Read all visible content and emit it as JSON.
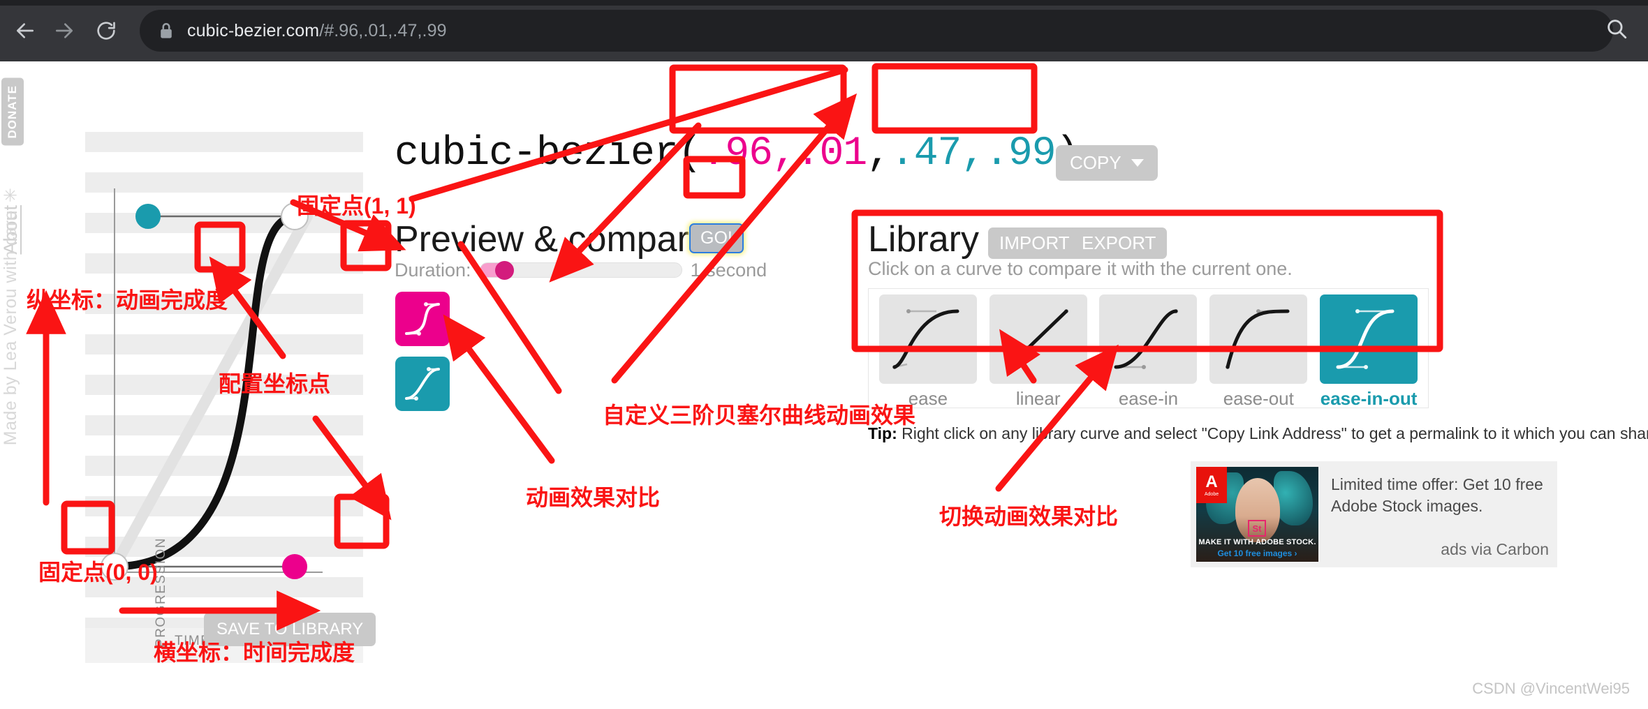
{
  "browser": {
    "url_host": "cubic-bezier.com",
    "url_path": "/#.96,.01,.47,.99",
    "back_icon": "arrow-left-icon",
    "forward_icon": "arrow-right-icon",
    "reload_icon": "reload-icon",
    "lock_icon": "lock-icon",
    "search_icon": "search-icon"
  },
  "sidebar": {
    "donate_label": "DONATE",
    "about_label": "About",
    "credits": "Made by Lea Verou with care ✳"
  },
  "title": {
    "func_name": "cubic-bezier",
    "open_paren": "(",
    "p1": ".96,.01",
    "sep": ",",
    "p2": ".47,.99",
    "close_paren": ")",
    "copy_label": "COPY",
    "pink_hex": "#ec008c",
    "teal_hex": "#1a9bad"
  },
  "editor": {
    "y_axis_label": "PROGRESSION",
    "x_axis_label": "TIME",
    "save_label": "SAVE TO LIBRARY",
    "p1_color": "#1a9bad",
    "p2_color": "#ec008c",
    "p1_value": ".96,.01",
    "p2_value": ".47,.99"
  },
  "preview": {
    "heading": "Preview & compare",
    "go_label": "GO!",
    "duration_label": "Duration:",
    "duration_value": "1 second",
    "swatch_custom": "#ec008c",
    "swatch_compare": "#1a9bad"
  },
  "library": {
    "heading": "Library",
    "import_label": "IMPORT",
    "export_label": "EXPORT",
    "hint": "Click on a curve to compare it with the current one.",
    "items": [
      {
        "label": "ease",
        "selected": false
      },
      {
        "label": "linear",
        "selected": false
      },
      {
        "label": "ease-in",
        "selected": false
      },
      {
        "label": "ease-out",
        "selected": false
      },
      {
        "label": "ease-in-out",
        "selected": true
      }
    ],
    "tip_prefix": "Tip:",
    "tip_text": " Right click on any library curve and select \"Copy Link Address\" to get a permalink to it which you can share with others"
  },
  "ad": {
    "brand": "Adobe",
    "brand_glyph": "A",
    "product_badge": "St",
    "caption_line1": "MAKE IT WITH ADOBE STOCK.",
    "caption_line2": "Get 10 free images ›",
    "copy_line1": "Limited time offer: Get 10 free",
    "copy_line2": "Adobe Stock images.",
    "via": "ads via Carbon"
  },
  "annotations": {
    "color": "#fa1414",
    "fixed_point_11": "固定点(1, 1)",
    "y_axis_note": "纵坐标：动画完成度",
    "control_points": "配置坐标点",
    "fixed_point_00": "固定点(0, 0)",
    "x_axis_note": "横坐标：时间完成度",
    "custom_curve": "自定义三阶贝塞尔曲线动画效果",
    "compare_effects": "动画效果对比",
    "switch_compare": "切换动画效果对比"
  },
  "watermark": "CSDN @VincentWei95"
}
